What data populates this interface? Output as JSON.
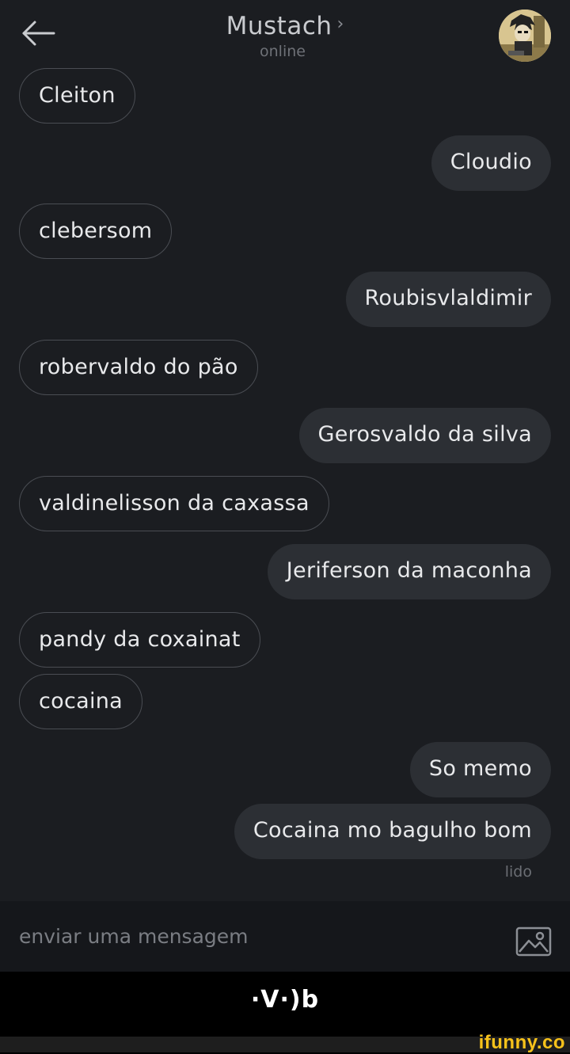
{
  "header": {
    "back_icon": "arrow-left-icon",
    "title": "Mustach",
    "title_chevron": "›",
    "status": "online",
    "avatar_icon": "contact-avatar"
  },
  "messages": [
    {
      "side": "in",
      "text": "Cleiton"
    },
    {
      "side": "out",
      "text": "Cloudio"
    },
    {
      "side": "in",
      "text": "clebersom"
    },
    {
      "side": "out",
      "text": "Roubisvlaldimir"
    },
    {
      "side": "in",
      "text": "robervaldo do pão"
    },
    {
      "side": "out",
      "text": "Gerosvaldo da silva"
    },
    {
      "side": "in",
      "text": "valdinelisson da caxassa"
    },
    {
      "side": "out",
      "text": "Jeriferson da maconha"
    },
    {
      "side": "in",
      "text": "pandy da coxainat"
    },
    {
      "side": "in",
      "text": "cocaina"
    },
    {
      "side": "out",
      "text": "So memo"
    },
    {
      "side": "out",
      "text": "Cocaina mo bagulho bom"
    }
  ],
  "read_receipt": "lido",
  "composer": {
    "placeholder": "enviar uma mensagem",
    "image_icon": "image-icon"
  },
  "caption": "·V·)b",
  "watermark": "ifunny.co",
  "colors": {
    "background": "#1b1d21",
    "outgoing_bubble": "#2c2f34",
    "incoming_border": "#4a4d53",
    "composer_bg": "#15171b",
    "watermark": "#f7c21b"
  }
}
